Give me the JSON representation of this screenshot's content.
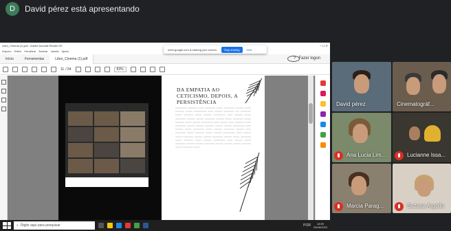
{
  "meet": {
    "presenter_initial": "D",
    "presenter_text": "David pérez está apresentando",
    "participants": [
      {
        "name": "David pérez",
        "muted": false
      },
      {
        "name": "Cinematográf...",
        "muted": false
      },
      {
        "name": "Ana Lucia Lim...",
        "muted": true
      },
      {
        "name": "Lucianne Issa...",
        "muted": true
      },
      {
        "name": "Marcia Parag...",
        "muted": true
      },
      {
        "name": "Suzana Argollo",
        "muted": true
      }
    ]
  },
  "acrobat": {
    "window_title": "Libro_Cinema (1).pdf - Adobe Acrobat Reader DC",
    "menu": [
      "Arquivo",
      "Editar",
      "Visualizar",
      "Assinar",
      "Janela",
      "Ajuda"
    ],
    "tabs": [
      "Início",
      "Ferramentas",
      "Libro_Cinema (1).pdf"
    ],
    "login": "Fazer logon",
    "page_current": "11",
    "page_total": "/ 54",
    "zoom": "83%",
    "share_notice": "meet.google.com is sharing your screen.",
    "stop_sharing": "Stop sharing",
    "hide": "Hide",
    "chapter_title": "DA EMPATIA AO CETICISMO, DEPOIS, A PERSISTÊNCIA"
  },
  "taskbar": {
    "search_placeholder": "Digite aqui para pesquisar",
    "lang": "POR",
    "time": "18:59",
    "date": "29/06/2020"
  },
  "colors": {
    "meet_bg": "#202124",
    "muted_red": "#d93025",
    "share_blue": "#1a73e8"
  }
}
